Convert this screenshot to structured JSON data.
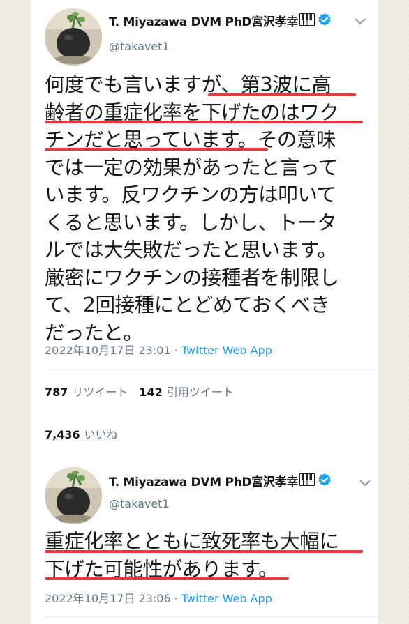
{
  "tweets": [
    {
      "display_name": "T. Miyazawa DVM PhD宮沢孝幸",
      "handle": "@takavet1",
      "lines": [
        "何度でも言いますが、第3波に高",
        "齢者の重症化率を下げたのはワク",
        "チンだと思っています。その意味",
        "では一定の効果があったと言って",
        "います。反ワクチンの方は叩いて",
        "くると思います。しかし、トータ",
        "ルでは大失敗だったと思います。",
        "厳密にワクチンの接種者を制限し",
        "て、2回接種にとどめておくべき",
        "だったと。"
      ],
      "timestamp": "2022年10月17日 23:01",
      "separator": " · ",
      "source": "Twitter Web App",
      "retweets_count": "787",
      "retweets_label": "リツイート",
      "quotes_count": "142",
      "quotes_label": "引用ツイート",
      "likes_count": "7,436",
      "likes_label": "いいね"
    },
    {
      "display_name": "T. Miyazawa DVM PhD宮沢孝幸",
      "handle": "@takavet1",
      "lines": [
        "重症化率とともに致死率も大幅に",
        "下げた可能性があります。"
      ],
      "timestamp": "2022年10月17日 23:06",
      "separator": " · ",
      "source": "Twitter Web App"
    }
  ],
  "colors": {
    "underline": "#e23b3b",
    "verified": "#1da1f2",
    "link": "#1da1f2",
    "muted": "#657786"
  },
  "icons": [
    "avatar-photo",
    "piano-icon",
    "verified-icon",
    "chevron-down-icon"
  ]
}
